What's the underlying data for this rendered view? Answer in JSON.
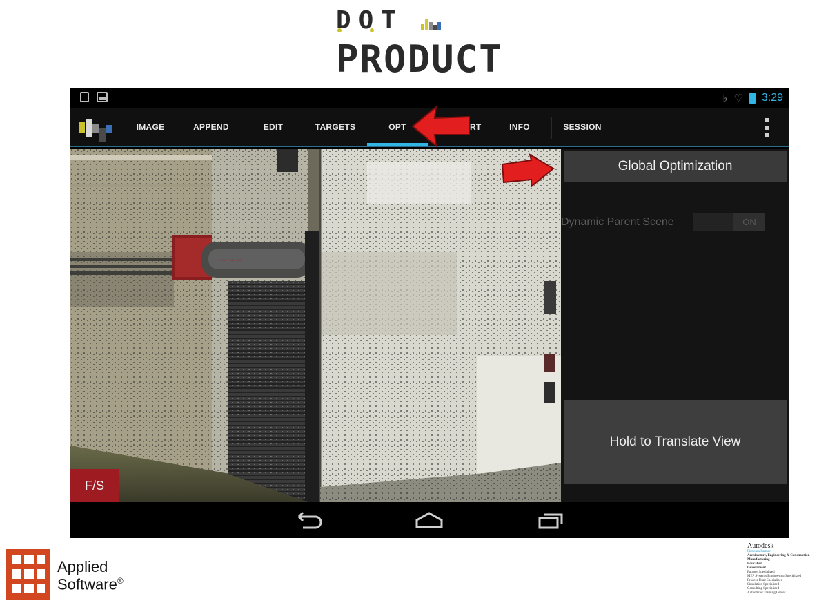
{
  "dotproduct_logo": {
    "line1": "DOT",
    "line2": "PRODUCT"
  },
  "status_bar": {
    "time": "3:29"
  },
  "action_bar": {
    "tabs": [
      {
        "label": "IMAGE",
        "selected": false
      },
      {
        "label": "APPEND",
        "selected": false
      },
      {
        "label": "EDIT",
        "selected": false
      },
      {
        "label": "TARGETS",
        "selected": false
      },
      {
        "label": "OPT",
        "selected": true
      },
      {
        "label": "EXPORT",
        "selected": false
      },
      {
        "label": "INFO",
        "selected": false
      },
      {
        "label": "SESSION",
        "selected": false
      }
    ]
  },
  "viewport": {
    "fullscreen_button": "F/S"
  },
  "panel": {
    "global_optimization_button": "Global Optimization",
    "dynamic_parent_scene_label": "Dynamic Parent Scene",
    "dynamic_parent_scene_toggle": "ON",
    "hold_translate_button": "Hold to Translate View"
  },
  "applied_logo": {
    "line1": "Applied",
    "line2": "Software"
  },
  "autodesk_partner": {
    "name": "Autodesk",
    "lines": [
      "Platinum Partner",
      "Architecture, Engineering & Construction",
      "Manufacturing",
      "Education",
      "Government",
      "Factory Specialized",
      "MEP Systems Engineering Specialized",
      "Process Plant Specialized",
      "Simulation Specialized",
      "Consulting Specialized",
      "Authorized Training Center"
    ]
  },
  "colors": {
    "accent_blue": "#31b5e5",
    "fs_red": "#9e1b22",
    "arrow_red": "#e31e1e",
    "applied_orange": "#d2471f"
  },
  "icons": [
    "notification-icon",
    "image-icon",
    "no-sound-icon",
    "wifi-icon",
    "battery-icon",
    "app-logo-icon",
    "overflow-menu-icon",
    "back-icon",
    "home-icon",
    "recents-icon"
  ]
}
